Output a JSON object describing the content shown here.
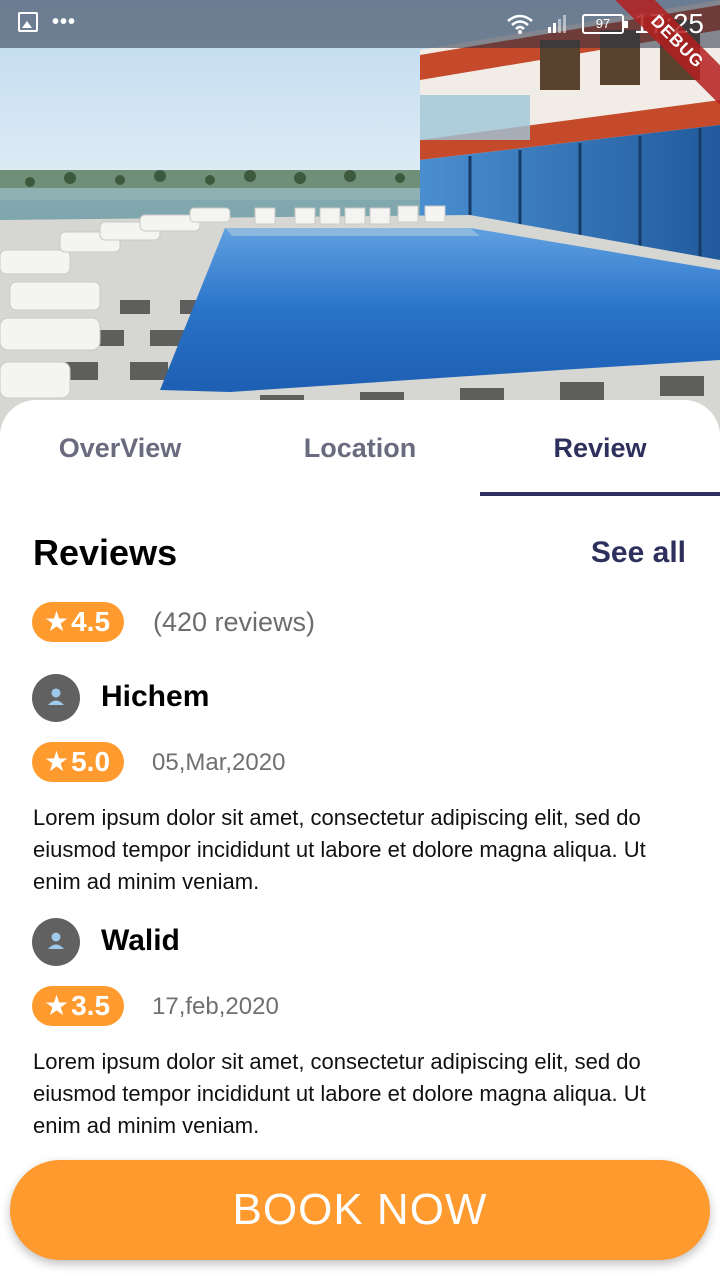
{
  "status_bar": {
    "time": "17:25",
    "battery": "97",
    "debug_label": "DEBUG",
    "more_icon": "•••"
  },
  "hero": {
    "subject": "hotel-pool-photo"
  },
  "tabs": [
    {
      "label": "OverView",
      "active": false
    },
    {
      "label": "Location",
      "active": false
    },
    {
      "label": "Review",
      "active": true
    }
  ],
  "reviews": {
    "title": "Reviews",
    "see_all_label": "See all",
    "summary": {
      "rating": "4.5",
      "count_text": "(420 reviews)"
    },
    "items": [
      {
        "name": "Hichem",
        "rating": "5.0",
        "date": "05,Mar,2020",
        "text": "Lorem ipsum dolor sit amet, consectetur adipiscing elit, sed do eiusmod tempor incididunt ut labore et dolore magna aliqua. Ut enim ad minim veniam."
      },
      {
        "name": "Walid",
        "rating": "3.5",
        "date": "17,feb,2020",
        "text": "Lorem ipsum dolor sit amet, consectetur adipiscing elit, sed do eiusmod tempor incididunt ut labore et dolore magna aliqua. Ut enim ad minim veniam."
      }
    ]
  },
  "book_button_label": "BOOK NOW",
  "colors": {
    "accent": "#ff9a2e",
    "primary": "#2d2f5c",
    "avatar_bg": "#616161"
  },
  "icons": {
    "star": "★",
    "avatar": "person-icon"
  }
}
